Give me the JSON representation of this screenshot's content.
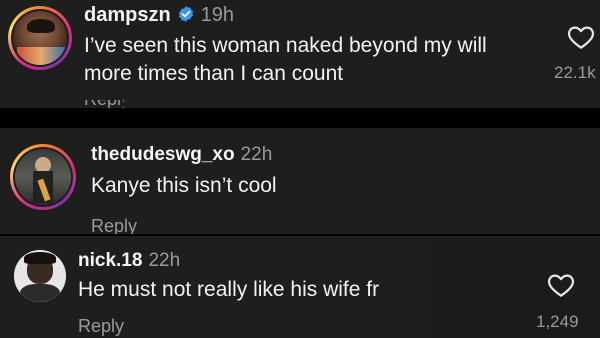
{
  "comments": [
    {
      "username": "dampszn",
      "time": "19h",
      "verified": true,
      "text_lines": [
        "I’ve seen this woman naked beyond my will",
        "more times than I can count"
      ],
      "likes": "22.1k"
    },
    {
      "username": "thedudeswg_xo",
      "time": "22h",
      "text_lines": [
        "Kanye this isn’t cool"
      ],
      "reply_label": "Reply"
    },
    {
      "username": "nick.18",
      "time": "22h",
      "text_lines": [
        "He must not really like his wife fr"
      ],
      "reply_label": "Reply",
      "likes": "1,249"
    }
  ],
  "colors": {
    "background": "#1e1e1e",
    "verified_blue": "#3897f0",
    "secondary_text": "#9a9a9a"
  },
  "icons": [
    "verified-badge-icon",
    "heart-icon"
  ]
}
